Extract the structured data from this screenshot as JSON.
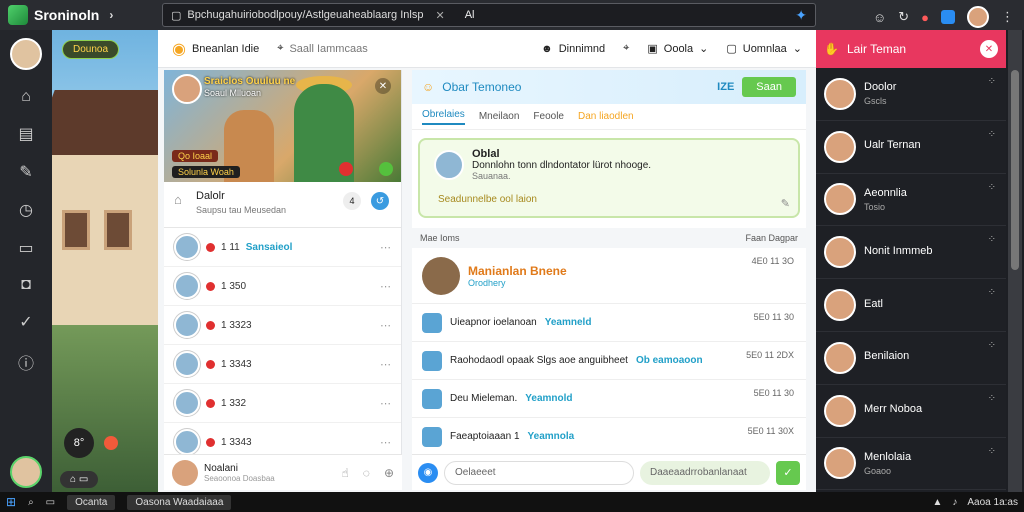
{
  "app": {
    "title": "Sroninoln",
    "url": "Bpchugahuiriobodlpouy/Astlgeuaheablaarg Inlsp",
    "query": "Al"
  },
  "sidebar_tag": "Dounoa",
  "nav": {
    "home": "Bneanlan Idie",
    "friends": "Saall Iammcaas",
    "group": "Dinnimnd",
    "more": "Ooola",
    "market": "Uomnlaa"
  },
  "hero": {
    "line1": "Sraiclos Ouuluu ne",
    "line2": "Soaul Mlluoan",
    "pill": "Qo Ioaal",
    "pill2": "Solunla Woah"
  },
  "post": {
    "title": "Dalolr",
    "subtitle": "Saupsu tau Meusedan",
    "page": "4"
  },
  "feed_rows": [
    {
      "n": "1 11",
      "hl": "Sansaieol"
    },
    {
      "n": "1 350",
      "hl": ""
    },
    {
      "n": "1 3323",
      "hl": ""
    },
    {
      "n": "1 3343",
      "hl": ""
    },
    {
      "n": "1 332",
      "hl": ""
    },
    {
      "n": "1 3343",
      "hl": ""
    }
  ],
  "compose": {
    "t1": "Noalani",
    "t2": "Seaoonoa Doasbaa"
  },
  "chat": {
    "title": "Obar Temoneo",
    "btn_id": "IZE",
    "btn": "Saan",
    "tabs": [
      "Obrelaies",
      "Mneilaon",
      "Feoole",
      "Dan liaodlen"
    ]
  },
  "bubble": {
    "name": "Oblal",
    "msg": "Donnlohn tonn dlndontator lürot nhooge.",
    "sub": "Sauanaa.",
    "badge": "Seadunnelbe ool laion"
  },
  "msghead": {
    "left": "Mae Ioms",
    "right": "Faan Dagpar"
  },
  "messages": [
    {
      "name": "Manianlan Bnene",
      "sub": "Orodhery",
      "time": "4E0 11 3O"
    },
    {
      "name": "Uieapnor ioelanoan",
      "hl": "Yeamneld",
      "time": "5E0 11 30"
    },
    {
      "name": "Raohodaodl opaak Slgs aoe anguibheet",
      "hl": "Ob eamoaoon",
      "time": "5E0 11 2DX"
    },
    {
      "name": "Deu Mieleman.",
      "hl": "Yeamnold",
      "time": "5E0 11 30"
    },
    {
      "name": "Faeaptoiaaan 1",
      "hl": "Yeamnola",
      "time": "5E0 11 30X"
    }
  ],
  "composer": {
    "placeholder": "Oelaeeet",
    "hint": "Daaeaadrrobanlanaat"
  },
  "right": {
    "title": "Lair Teman",
    "contacts": [
      {
        "n": "Doolor",
        "s": "Gscls"
      },
      {
        "n": "Ualr Ternan",
        "s": ""
      },
      {
        "n": "Aeonnlia",
        "s": "Tosio"
      },
      {
        "n": "Nonit Inmmeb",
        "s": ""
      },
      {
        "n": "Eatl",
        "s": ""
      },
      {
        "n": "Benilaion",
        "s": ""
      },
      {
        "n": "Merr Noboa",
        "s": ""
      },
      {
        "n": "Menlolaia",
        "s": "Goaoo"
      }
    ]
  },
  "taskbar": {
    "app1": "Ocanta",
    "app2": "Oasona Waadaiaaa",
    "time": "Aaoa 1a:as"
  }
}
